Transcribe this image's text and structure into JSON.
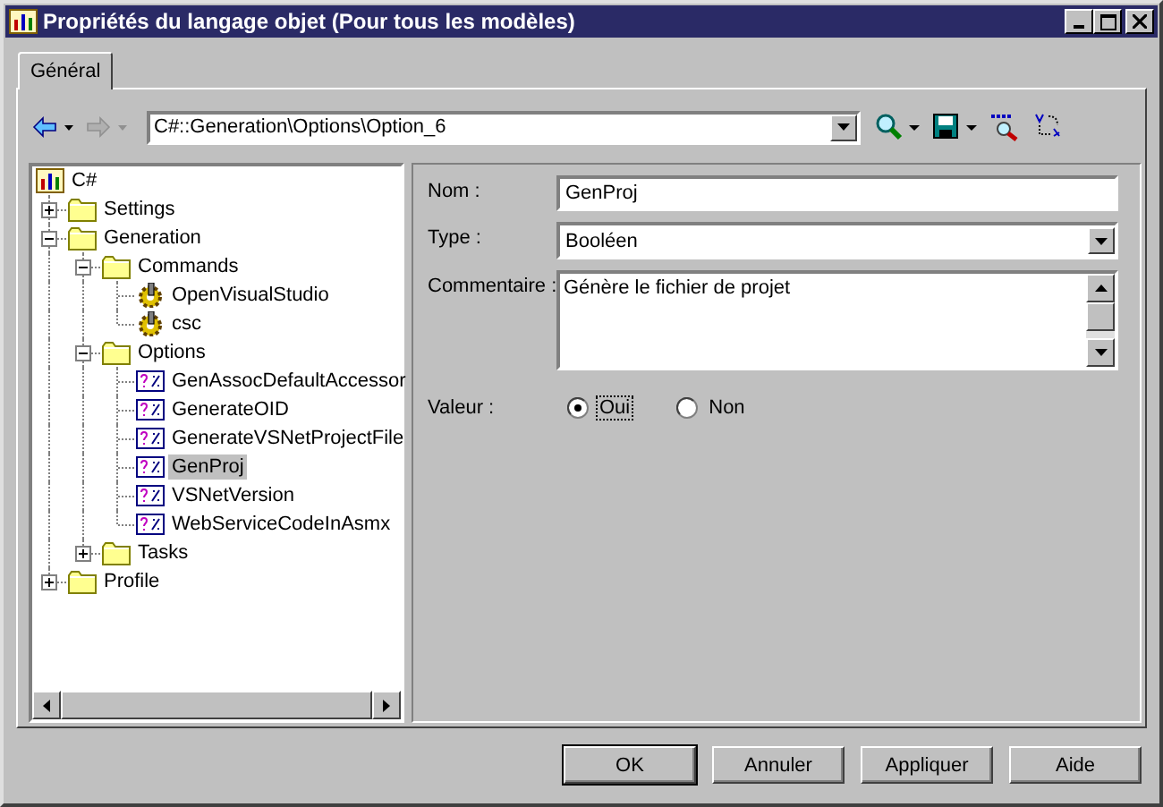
{
  "window": {
    "title": "Propriétés du langage objet (Pour tous les modèles)"
  },
  "tabs": [
    {
      "label": "Général",
      "selected": true
    }
  ],
  "toolbar": {
    "back": {
      "disabled": false
    },
    "forward": {
      "disabled": true
    },
    "path": "C#::Generation\\Options\\Option_6"
  },
  "tree": [
    {
      "label": "C#",
      "kind": "root",
      "selected": false,
      "children": [
        {
          "label": "Settings",
          "kind": "folder",
          "expanded": false,
          "selected": false
        },
        {
          "label": "Generation",
          "kind": "folder",
          "expanded": true,
          "selected": false,
          "children": [
            {
              "label": "Commands",
              "kind": "folder",
              "expanded": true,
              "selected": false,
              "children": [
                {
                  "label": "OpenVisualStudio",
                  "kind": "command",
                  "selected": false
                },
                {
                  "label": "csc",
                  "kind": "command",
                  "selected": false
                }
              ]
            },
            {
              "label": "Options",
              "kind": "folder",
              "expanded": true,
              "selected": false,
              "children": [
                {
                  "label": "GenAssocDefaultAccessor",
                  "kind": "option",
                  "selected": false
                },
                {
                  "label": "GenerateOID",
                  "kind": "option",
                  "selected": false
                },
                {
                  "label": "GenerateVSNetProjectFile",
                  "kind": "option",
                  "selected": false
                },
                {
                  "label": "GenProj",
                  "kind": "option",
                  "selected": true
                },
                {
                  "label": "VSNetVersion",
                  "kind": "option",
                  "selected": false
                },
                {
                  "label": "WebServiceCodeInAsmx",
                  "kind": "option",
                  "selected": false
                }
              ]
            },
            {
              "label": "Tasks",
              "kind": "folder",
              "expanded": false,
              "selected": false
            }
          ]
        },
        {
          "label": "Profile",
          "kind": "folder",
          "expanded": false,
          "selected": false
        }
      ]
    }
  ],
  "form": {
    "fields": [
      {
        "label": "Nom :",
        "kind": "text",
        "value": "GenProj"
      },
      {
        "label": "Type :",
        "kind": "combo",
        "value": "Booléen"
      },
      {
        "label": "Commentaire :",
        "kind": "memo",
        "value": "Génère le fichier de projet"
      }
    ],
    "value_label": "Valeur :",
    "options": [
      {
        "label": "Oui",
        "selected": true
      },
      {
        "label": "Non",
        "selected": false
      }
    ]
  },
  "buttons": [
    {
      "label": "OK",
      "default": true
    },
    {
      "label": "Annuler",
      "default": false
    },
    {
      "label": "Appliquer",
      "default": false
    },
    {
      "label": "Aide",
      "default": false
    }
  ]
}
